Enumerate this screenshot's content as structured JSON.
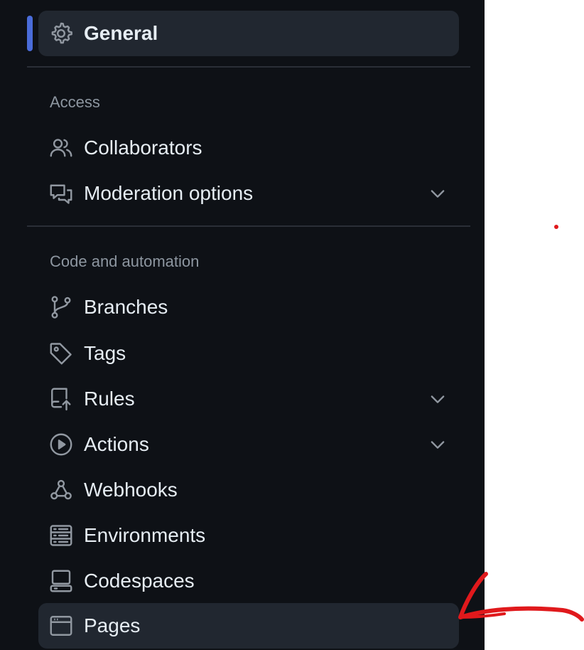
{
  "sidebar": {
    "general": {
      "label": "General",
      "icon": "gear-icon"
    },
    "sections": [
      {
        "heading": "Access",
        "items": [
          {
            "label": "Collaborators",
            "icon": "people-icon",
            "expandable": false
          },
          {
            "label": "Moderation options",
            "icon": "comment-discussion-icon",
            "expandable": true
          }
        ]
      },
      {
        "heading": "Code and automation",
        "items": [
          {
            "label": "Branches",
            "icon": "git-branch-icon",
            "expandable": false
          },
          {
            "label": "Tags",
            "icon": "tag-icon",
            "expandable": false
          },
          {
            "label": "Rules",
            "icon": "repo-push-icon",
            "expandable": true
          },
          {
            "label": "Actions",
            "icon": "play-icon",
            "expandable": true
          },
          {
            "label": "Webhooks",
            "icon": "webhook-icon",
            "expandable": false
          },
          {
            "label": "Environments",
            "icon": "server-icon",
            "expandable": false
          },
          {
            "label": "Codespaces",
            "icon": "codespaces-icon",
            "expandable": false
          },
          {
            "label": "Pages",
            "icon": "browser-icon",
            "expandable": false
          }
        ]
      }
    ]
  },
  "colors": {
    "background": "#0e1116",
    "active_item": "#212730",
    "accent_indicator": "#4a6cd9",
    "text": "#e6edf3",
    "muted_text": "#8d96a0",
    "annotation": "#e0191c"
  }
}
